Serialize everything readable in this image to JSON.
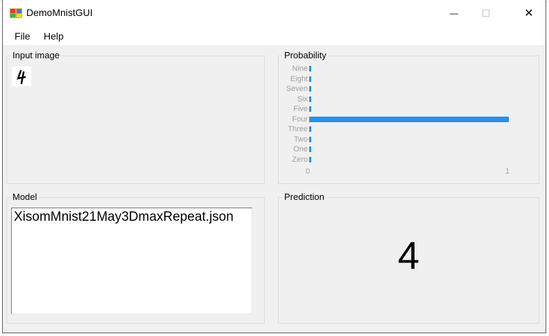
{
  "window": {
    "title": "DemoMnistGUI",
    "minimize": "—",
    "maximize": "☐",
    "close": "✕"
  },
  "menu": [
    "File",
    "Help"
  ],
  "input_image": {
    "label": "Input image",
    "glyph": "4"
  },
  "probability": {
    "label": "Probability",
    "tick_min": "0",
    "tick_max": "1"
  },
  "model": {
    "label": "Model",
    "value": "XisomMnist21May3DmaxRepeat.json"
  },
  "prediction": {
    "label": "Prediction",
    "value": "4"
  },
  "chart_data": {
    "type": "bar",
    "orientation": "horizontal",
    "categories": [
      "Nine",
      "Eight",
      "Seven",
      "Six",
      "Five",
      "Four",
      "Three",
      "Two",
      "One",
      "Zero"
    ],
    "values": [
      0.0,
      0.0,
      0.0,
      0.0,
      0.0,
      1.0,
      0.0,
      0.0,
      0.0,
      0.0
    ],
    "xlim": [
      0,
      1
    ],
    "bar_color": "#2b8fe6"
  },
  "colors": {
    "bar": "#2b8fe6",
    "label_gray": "#a0a0a0"
  }
}
